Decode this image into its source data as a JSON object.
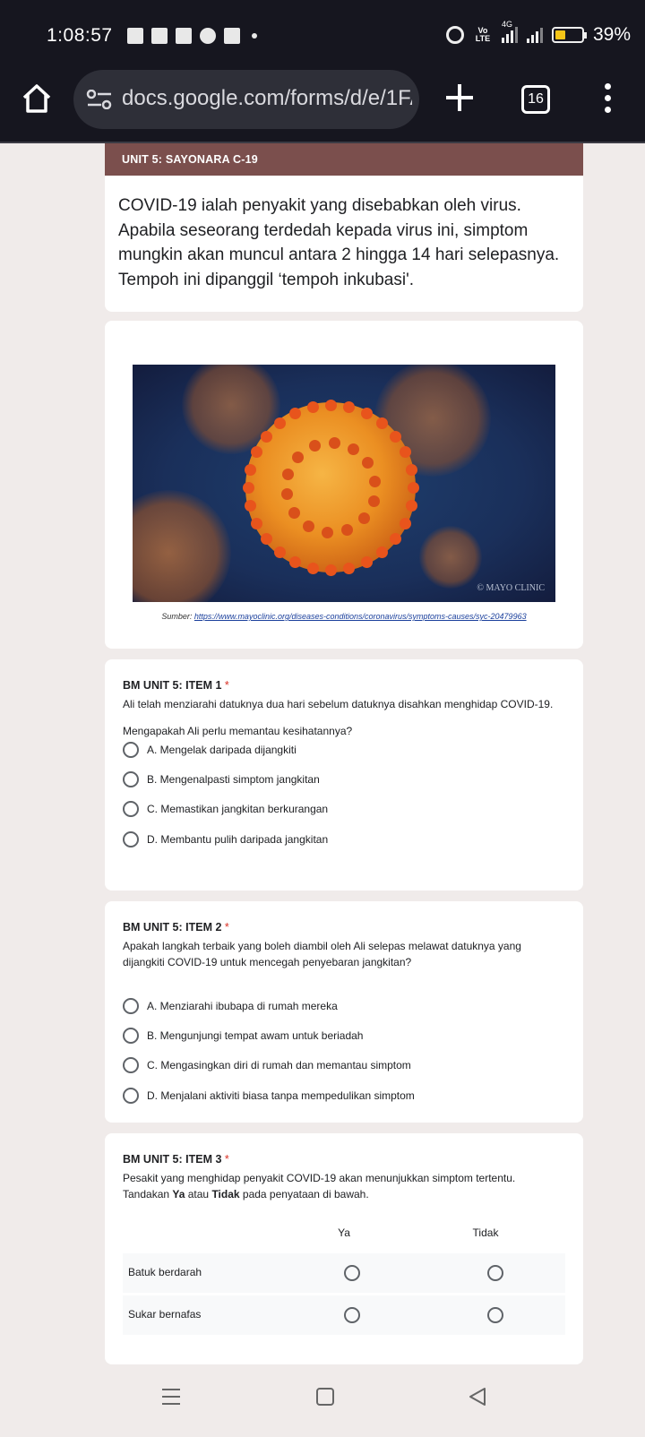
{
  "status_bar": {
    "time": "1:08:57",
    "volte": "Vo LTE",
    "network": "4G",
    "battery_percent": "39%",
    "battery_level": 0.39
  },
  "browser": {
    "url": "docs.google.com/forms/d/e/1FA",
    "tab_count": "16"
  },
  "form": {
    "section_title": "UNIT 5: SAYONARA C-19",
    "description": "COVID-19 ialah penyakit yang disebabkan oleh virus. Apabila seseorang terdedah kepada virus ini, simptom mungkin akan muncul antara 2 hingga 14 hari selepasnya. Tempoh ini dipanggil ‘tempoh inkubasi'.",
    "image": {
      "credit": "© MAYO CLINIC",
      "source_label": "Sumber:",
      "source_url": "https://www.mayoclinic.org/diseases-conditions/coronavirus/symptoms-causes/syc-20479963"
    },
    "questions": [
      {
        "title": "BM UNIT 5: ITEM 1",
        "required_mark": "*",
        "text1": "Ali telah menziarahi datuknya dua hari sebelum datuknya disahkan menghidap COVID-19.",
        "text2": "Mengapakah Ali perlu memantau kesihatannya?",
        "options": [
          "A. Mengelak daripada dijangkiti",
          "B. Mengenalpasti simptom jangkitan",
          "C. Memastikan jangkitan berkurangan",
          "D. Membantu pulih daripada jangkitan"
        ]
      },
      {
        "title": "BM UNIT 5: ITEM 2",
        "required_mark": "*",
        "text1": "Apakah langkah terbaik yang boleh diambil oleh Ali selepas melawat datuknya yang dijangkiti COVID-19 untuk mencegah penyebaran jangkitan?",
        "options": [
          "A. Menziarahi ibubapa di rumah mereka",
          "B. Mengunjungi tempat awam untuk beriadah",
          "C. Mengasingkan diri di rumah dan memantau simptom",
          "D. Menjalani aktiviti biasa tanpa mempedulikan simptom"
        ]
      },
      {
        "title": "BM UNIT 5: ITEM 3",
        "required_mark": "*",
        "text1": "Pesakit yang menghidap penyakit COVID-19 akan menunjukkan simptom tertentu.",
        "text2_pre": "Tandakan ",
        "text2_ya": "Ya",
        "text2_mid": " atau ",
        "text2_tidak": "Tidak",
        "text2_post": " pada penyataan di bawah.",
        "columns": [
          "Ya",
          "Tidak"
        ],
        "rows": [
          "Batuk berdarah",
          "Sukar bernafas"
        ]
      }
    ]
  },
  "colors": {
    "section_header": "#7b4f4d",
    "background": "#f0ebea",
    "status_bar": "#16161f",
    "required": "#d93025"
  }
}
